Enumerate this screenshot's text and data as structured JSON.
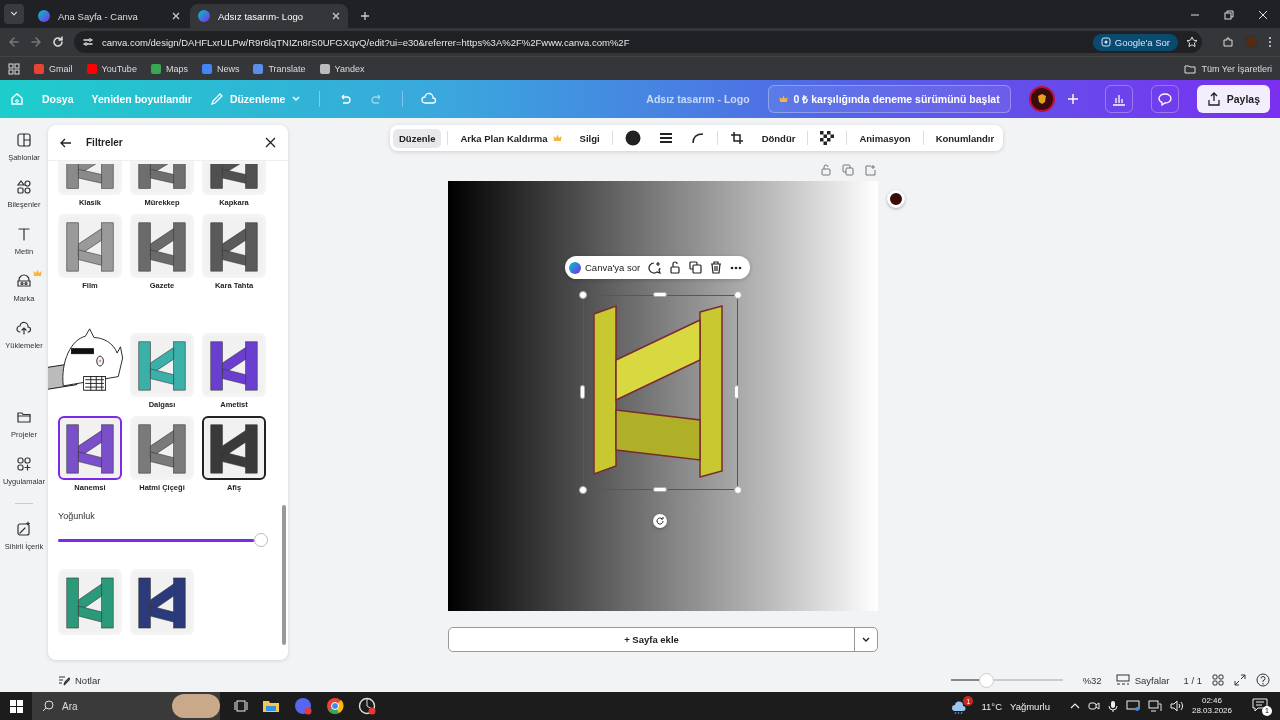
{
  "browser": {
    "tabs": [
      {
        "title": "Ana Sayfa - Canva",
        "selected": false
      },
      {
        "title": "Adsız tasarım- Logo",
        "selected": true
      }
    ],
    "url": "canva.com/design/DAHFLxrULPw/R9r6lqTNIZn8rS0UFGXqvQ/edit?ui=e30&referrer=https%3A%2F%2Fwww.canva.com%2F",
    "ask_button": "Google'a Sor",
    "bookmarks": [
      "Gmail",
      "YouTube",
      "Maps",
      "News",
      "Translate",
      "Yandex"
    ],
    "all_bookmarks": "Tüm Yer İşaretleri"
  },
  "header": {
    "menu": [
      "Dosya",
      "Yeniden boyutlandır"
    ],
    "edit_mode": "Düzenleme",
    "doc_title": "Adsız tasarım - Logo",
    "trial": "0 ₺ karşılığında deneme sürümünü başlat",
    "share": "Paylaş"
  },
  "rail": [
    {
      "label": "Şablonlar",
      "premium": false
    },
    {
      "label": "Bileşenler",
      "premium": false
    },
    {
      "label": "Metin",
      "premium": false
    },
    {
      "label": "Marka",
      "premium": true
    },
    {
      "label": "Yüklemeler",
      "premium": false
    },
    {
      "label": "Projeler",
      "premium": false
    },
    {
      "label": "Uygulamalar",
      "premium": false
    },
    {
      "label": "Sihirli İçerik",
      "premium": false
    }
  ],
  "panel": {
    "title": "Filtreler",
    "filters": [
      {
        "label": "Klasik",
        "color": "#8a8a8a",
        "selected": false,
        "hovered": false
      },
      {
        "label": "Mürekkep",
        "color": "#6e6e6e",
        "selected": false,
        "hovered": false
      },
      {
        "label": "Kapkara",
        "color": "#505050",
        "selected": false,
        "hovered": false
      },
      {
        "label": "Film",
        "color": "#9a9a9a",
        "selected": false,
        "hovered": false
      },
      {
        "label": "Gazete",
        "color": "#6a6a6a",
        "selected": false,
        "hovered": false
      },
      {
        "label": "Kara Tahta",
        "color": "#5a5a5a",
        "selected": false,
        "hovered": false
      },
      {
        "label": "Dalgası",
        "color": "#3bb0a8",
        "selected": false,
        "hovered": false
      },
      {
        "label": "Ametist",
        "color": "#6a3fd0",
        "selected": false,
        "hovered": false
      },
      {
        "label": "Nanemsi",
        "color": "#7b4fc9",
        "selected": true,
        "hovered": false
      },
      {
        "label": "Hatmi Çiçeği",
        "color": "#7a7a7a",
        "selected": false,
        "hovered": false
      },
      {
        "label": "Afiş",
        "color": "#3a3a3a",
        "selected": false,
        "hovered": true
      }
    ],
    "intensity": {
      "label": "Yoğunluk",
      "level": 0.97
    },
    "more_filters": [
      {
        "color": "#2a9a7a"
      },
      {
        "color": "#2a3a7a"
      }
    ]
  },
  "toolbar": [
    {
      "kind": "text",
      "label": "Düzenle",
      "premium": false,
      "selected": true
    },
    {
      "kind": "text",
      "label": "Arka Plan Kaldırma",
      "premium": true,
      "selected": false
    },
    {
      "kind": "text",
      "label": "Silgi",
      "premium": false,
      "selected": false
    },
    {
      "kind": "color",
      "selected": false
    },
    {
      "kind": "border",
      "selected": false
    },
    {
      "kind": "corner",
      "selected": false
    },
    {
      "kind": "crop",
      "selected": false
    },
    {
      "kind": "text",
      "label": "Döndür",
      "premium": false,
      "selected": false
    },
    {
      "kind": "transparency",
      "selected": false
    },
    {
      "kind": "text",
      "label": "Animasyon",
      "premium": false,
      "selected": false
    },
    {
      "kind": "text",
      "label": "Konumlandır",
      "premium": false,
      "selected": false
    }
  ],
  "canvas": {
    "ask_canva": "Canva'ya sor",
    "add_page": "+ Sayfa ekle"
  },
  "footer": {
    "notes": "Notlar",
    "zoom": {
      "level": 0.32,
      "reading": "%32"
    },
    "pages": "Sayfalar",
    "page_count": "1 / 1"
  },
  "taskbar": {
    "search": {
      "placeholder": "Ara"
    },
    "weather": {
      "temperature": "11°C",
      "condition": "Yağmurlu",
      "badge": "1"
    },
    "time": "02:46",
    "date": "28.03.2026",
    "notifications": "1"
  }
}
